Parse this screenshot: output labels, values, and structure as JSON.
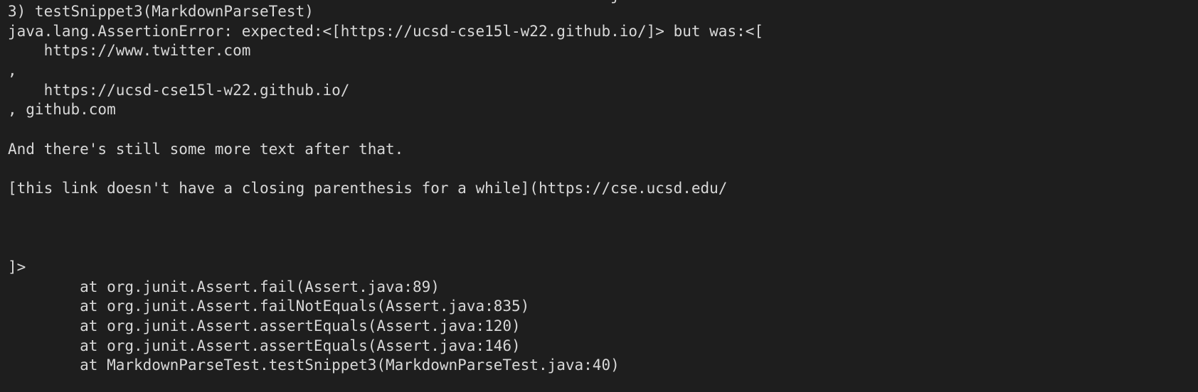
{
  "terminal": {
    "clipped_top_line": "                                                                   j",
    "lines": [
      "3) testSnippet3(MarkdownParseTest)",
      "java.lang.AssertionError: expected:<[https://ucsd-cse15l-w22.github.io/]> but was:<[",
      "    https://www.twitter.com",
      ",",
      "    https://ucsd-cse15l-w22.github.io/",
      ", github.com",
      "",
      "And there's still some more text after that.",
      "",
      "[this link doesn't have a closing parenthesis for a while](https://cse.ucsd.edu/",
      "",
      "",
      "",
      "]>",
      "        at org.junit.Assert.fail(Assert.java:89)",
      "        at org.junit.Assert.failNotEquals(Assert.java:835)",
      "        at org.junit.Assert.assertEquals(Assert.java:120)",
      "        at org.junit.Assert.assertEquals(Assert.java:146)",
      "        at MarkdownParseTest.testSnippet3(MarkdownParseTest.java:40)"
    ]
  }
}
